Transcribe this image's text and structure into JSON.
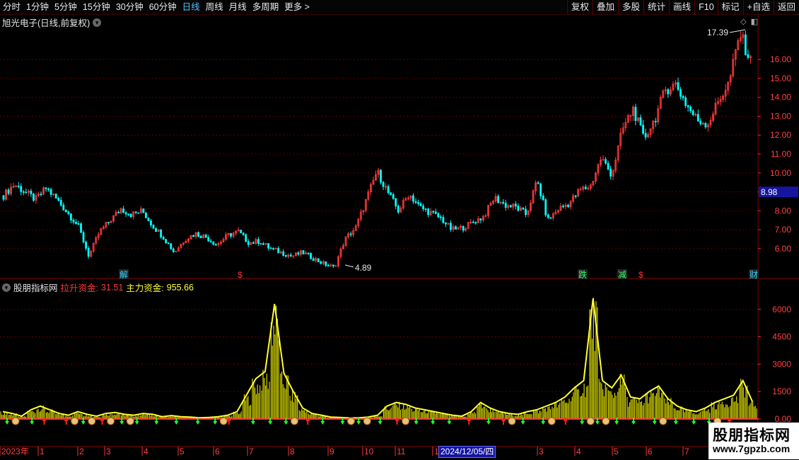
{
  "toolbar": {
    "periods": [
      "分时",
      "1分钟",
      "5分钟",
      "15分钟",
      "30分钟",
      "60分钟",
      "日线",
      "周线",
      "月线",
      "多周期",
      "更多 >"
    ],
    "active": "日线",
    "buttons": [
      "复权",
      "叠加",
      "多股",
      "统计",
      "画线",
      "F10",
      "标记",
      "+自选",
      "返回"
    ]
  },
  "main_chart": {
    "title": "旭光电子(日线,前复权)",
    "price_axis": [
      "16.00",
      "15.00",
      "14.00",
      "13.00",
      "12.00",
      "11.00",
      "10.00",
      "9.00",
      "8.00",
      "7.00",
      "6.00"
    ],
    "current_price_tag": "8.98",
    "high_label": "17.39",
    "low_label": "4.89",
    "event_markers": [
      {
        "text": "解",
        "color": "#3ad1ff"
      },
      {
        "text": "$",
        "color": "#ff3030"
      },
      {
        "text": "跌",
        "color": "#33ff66"
      },
      {
        "text": "减",
        "color": "#33ff66"
      },
      {
        "text": "$",
        "color": "#ff3030"
      },
      {
        "text": "财",
        "color": "#3ad1ff"
      }
    ]
  },
  "indicator": {
    "name": "股朋指标网",
    "line1_label": "拉升资金:",
    "line1_value": "31.51",
    "line2_label": "主力资金:",
    "line2_value": "955.66",
    "axis": [
      "6000",
      "4500",
      "3000",
      "1500",
      "0.00"
    ]
  },
  "time_axis": {
    "labels": [
      "2023年",
      "1",
      "2",
      "3",
      "4",
      "5",
      "6",
      "7",
      "8",
      "9",
      "10",
      "11",
      "1",
      "2",
      "3",
      "4",
      "5",
      "6",
      "7"
    ],
    "selected_date": "2024/12/05/四"
  },
  "watermark": {
    "line1": "股朋指标网",
    "line2": "www.7gpzb.com"
  },
  "colors": {
    "up": "#ff3b3b",
    "down": "#00ffff",
    "mid": "#ffff33",
    "grid": "#5a0000"
  },
  "chart_data": [
    {
      "type": "candlestick",
      "title": "旭光电子(日线,前复权)",
      "ylim": [
        4.5,
        17.8
      ],
      "y_ticks": [
        6,
        7,
        8,
        9,
        10,
        11,
        12,
        13,
        14,
        15,
        16
      ],
      "close_trend": [
        8.8,
        9.4,
        9.0,
        8.6,
        9.2,
        8.6,
        7.9,
        7.2,
        5.6,
        6.9,
        7.5,
        8.1,
        7.8,
        8.0,
        7.2,
        6.6,
        5.8,
        6.5,
        6.8,
        6.6,
        6.2,
        6.7,
        6.9,
        6.3,
        6.4,
        6.0,
        5.8,
        5.6,
        5.8,
        5.5,
        5.2,
        5.0,
        6.5,
        7.1,
        8.6,
        10.1,
        9.0,
        8.0,
        8.9,
        8.2,
        7.9,
        7.6,
        7.0,
        7.1,
        7.4,
        7.7,
        8.7,
        8.3,
        8.2,
        7.8,
        9.6,
        7.5,
        8.1,
        8.4,
        9.1,
        9.3,
        10.8,
        9.9,
        12.3,
        13.4,
        11.8,
        12.8,
        14.4,
        14.7,
        13.6,
        12.8,
        12.6,
        13.8,
        14.8,
        17.39,
        15.9
      ],
      "high": 17.39,
      "low": 4.89
    },
    {
      "type": "bar",
      "title": "股朋指标网",
      "ylim": [
        -200,
        7000
      ],
      "y_ticks": [
        0,
        1500,
        3000,
        4500,
        6000
      ],
      "series": [
        {
          "name": "主力资金",
          "values": [
            400,
            300,
            150,
            500,
            700,
            500,
            300,
            200,
            400,
            250,
            150,
            300,
            350,
            250,
            200,
            300,
            250,
            120,
            180,
            120,
            100,
            60,
            80,
            120,
            200,
            400,
            1300,
            2200,
            2600,
            6300,
            2500,
            1500,
            600,
            300,
            200,
            100,
            80,
            50,
            60,
            100,
            200,
            700,
            900,
            800,
            600,
            500,
            400,
            300,
            200,
            150,
            400,
            900,
            600,
            400,
            300,
            250,
            400,
            500,
            700,
            900,
            1200,
            1700,
            2100,
            6600,
            2100,
            1700,
            2400,
            1200,
            1100,
            1500,
            1800,
            1100,
            700,
            500,
            400,
            600,
            900,
            1100,
            1300,
            2100,
            955.66
          ]
        }
      ]
    }
  ]
}
